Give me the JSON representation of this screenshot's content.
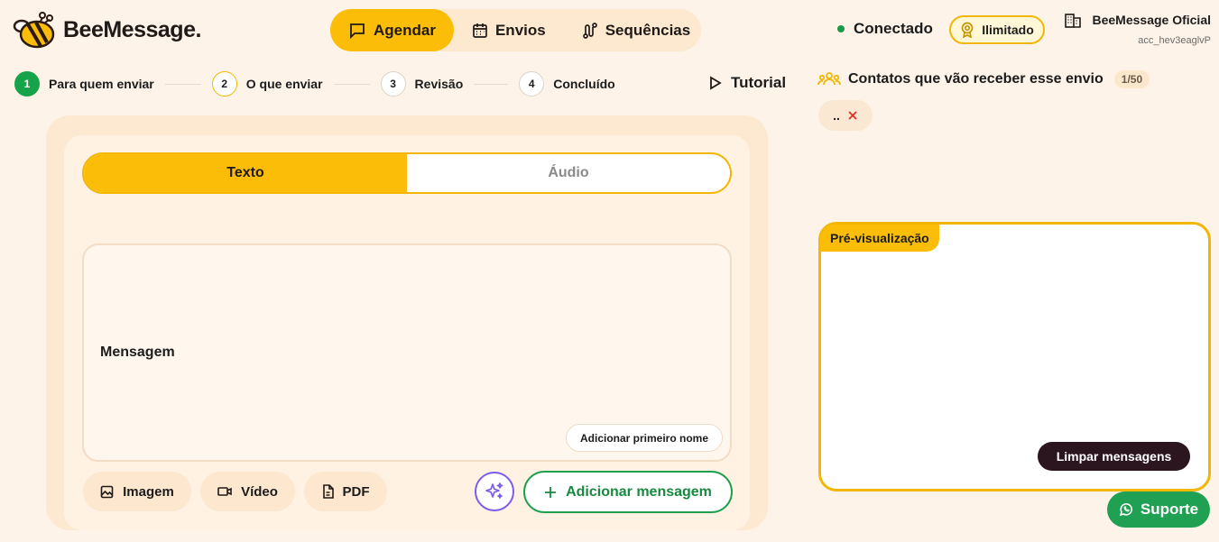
{
  "brand": {
    "name": "BeeMessage."
  },
  "nav": {
    "items": [
      {
        "label": "Agendar",
        "active": true,
        "icon": "message-square-icon"
      },
      {
        "label": "Envios",
        "active": false,
        "icon": "calendar-icon"
      },
      {
        "label": "Sequências",
        "active": false,
        "icon": "route-icon"
      }
    ]
  },
  "status": {
    "label": "Conectado",
    "color": "#1a9a48"
  },
  "plan": {
    "label": "Ilimitado",
    "icon": "award-icon"
  },
  "account": {
    "name": "BeeMessage Oficial",
    "id": "acc_hev3eaglvP",
    "icon": "building-icon"
  },
  "steps": [
    {
      "num": "1",
      "label": "Para quem enviar",
      "state": "done"
    },
    {
      "num": "2",
      "label": "O que enviar",
      "state": "current"
    },
    {
      "num": "3",
      "label": "Revisão",
      "state": "pending"
    },
    {
      "num": "4",
      "label": "Concluído",
      "state": "pending"
    }
  ],
  "tutorial": {
    "label": "Tutorial",
    "icon": "play-icon"
  },
  "contacts": {
    "title": "Contatos que vão receber esse envio",
    "count": "1/50",
    "chips": [
      {
        "label": "..",
        "remove_icon": "x-icon"
      }
    ]
  },
  "composer": {
    "tabs": [
      {
        "label": "Texto",
        "active": true
      },
      {
        "label": "Áudio",
        "active": false
      }
    ],
    "message_label": "Mensagem",
    "add_first_name": "Adicionar primeiro nome",
    "media_buttons": [
      {
        "label": "Imagem",
        "icon": "image-icon"
      },
      {
        "label": "Vídeo",
        "icon": "video-icon"
      },
      {
        "label": "PDF",
        "icon": "file-icon"
      }
    ],
    "ai_icon": "sparkles-icon",
    "add_message": "Adicionar mensagem"
  },
  "preview": {
    "title": "Pré-visualização",
    "clear": "Limpar mensagens"
  },
  "support": {
    "label": "Suporte",
    "icon": "whatsapp-icon"
  },
  "colors": {
    "accent": "#fbbd08",
    "green": "#1fa052",
    "background": "#fdf3e8",
    "dark": "#2b1620",
    "ai": "#7c5cf0"
  }
}
